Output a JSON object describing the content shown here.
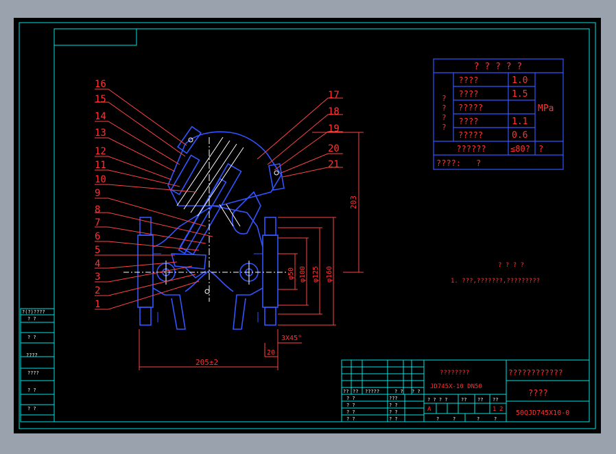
{
  "colors": {
    "background": "#000000",
    "frame": "#00ffff",
    "part": "#3355ff",
    "leader": "#ff4444",
    "text": "#ff3333",
    "white": "#ffffff"
  },
  "part_numbers": [
    "16",
    "15",
    "14",
    "13",
    "12",
    "11",
    "10",
    "9",
    "8",
    "7",
    "6",
    "5",
    "4",
    "3",
    "2",
    "1"
  ],
  "right_part_numbers": [
    "17",
    "18",
    "19",
    "20",
    "21"
  ],
  "dimensions": {
    "height": "203",
    "phi50": "φ50",
    "phi100": "φ100",
    "phi125": "φ125",
    "phi160": "φ160",
    "chamfer": "3X45°",
    "flange": "20",
    "length": "205±2"
  },
  "spec_table": {
    "title": "? ? ? ? ?",
    "rows": [
      {
        "name": "????",
        "value": "1.0"
      },
      {
        "name": "????",
        "value": "1.5"
      },
      {
        "name": "?????",
        "value": ""
      },
      {
        "name": "????",
        "value": "1.1"
      },
      {
        "name": "?????",
        "value": "0.6"
      }
    ],
    "side_label": [
      "?",
      "?",
      "?",
      "?"
    ],
    "unit": "MPa",
    "temp_name": "??????",
    "temp_value": "≤80?",
    "temp_unit": "?",
    "medium": "????:",
    "medium_value": "?"
  },
  "notes": {
    "title": "? ? ? ?",
    "line1": "1. ???,???????,?????????"
  },
  "left_strip": {
    "header": "?(?)????",
    "labels": [
      "?    ?",
      "?    ?",
      "????",
      "????",
      "?    ?",
      "?    ?"
    ]
  },
  "title_block": {
    "company": "????????",
    "model": "JD745X-10  DN50",
    "drawing_title": "????????????",
    "part_name": "????",
    "drawing_no": "50QJD745X10-0",
    "rev_header": [
      "??",
      "??",
      "?????",
      "? ?",
      "? ?"
    ],
    "sign_rows": [
      "? ?",
      "? ?",
      "? ?",
      "? ?"
    ],
    "sign_col": [
      "???",
      "? ?",
      "? ?",
      "? ?"
    ],
    "scale_header": [
      "? ? ? ?",
      "??",
      "??",
      "??"
    ],
    "scale_row": [
      "A",
      "",
      "",
      "1",
      "2"
    ],
    "sheet_row": [
      "?",
      "?",
      "?",
      "?"
    ]
  }
}
